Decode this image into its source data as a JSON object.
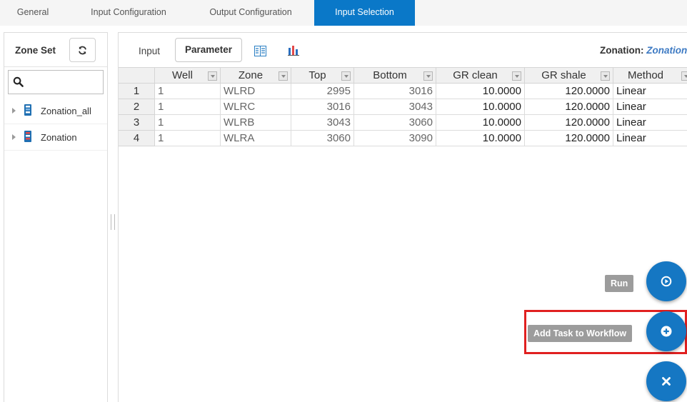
{
  "tabs": [
    {
      "label": "General"
    },
    {
      "label": "Input Configuration"
    },
    {
      "label": "Output Configuration"
    },
    {
      "label": "Input Selection"
    }
  ],
  "active_tab": "Input Selection",
  "left_panel": {
    "title": "Zone Set",
    "search": {
      "value": "",
      "placeholder": ""
    },
    "tree": [
      {
        "label": "Zonation_all"
      },
      {
        "label": "Zonation"
      }
    ]
  },
  "main_panel": {
    "toolbar": {
      "input_label": "Input",
      "parameter_label": "Parameter",
      "icons": [
        "grid-view-icon",
        "bar-chart-icon"
      ]
    },
    "zonation": {
      "label": "Zonation:",
      "value": "Zonation"
    },
    "table": {
      "columns": [
        "Well",
        "Zone",
        "Top",
        "Bottom",
        "GR clean",
        "GR shale",
        "Method"
      ],
      "rows": [
        {
          "num": "1",
          "well": "1",
          "zone": "WLRD",
          "top": "2995",
          "bottom": "3016",
          "gr_clean": "10.0000",
          "gr_shale": "120.0000",
          "method": "Linear"
        },
        {
          "num": "2",
          "well": "1",
          "zone": "WLRC",
          "top": "3016",
          "bottom": "3043",
          "gr_clean": "10.0000",
          "gr_shale": "120.0000",
          "method": "Linear"
        },
        {
          "num": "3",
          "well": "1",
          "zone": "WLRB",
          "top": "3043",
          "bottom": "3060",
          "gr_clean": "10.0000",
          "gr_shale": "120.0000",
          "method": "Linear"
        },
        {
          "num": "4",
          "well": "1",
          "zone": "WLRA",
          "top": "3060",
          "bottom": "3090",
          "gr_clean": "10.0000",
          "gr_shale": "120.0000",
          "method": "Linear"
        }
      ]
    }
  },
  "actions": {
    "run_label": "Run",
    "add_task_label": "Add Task to Workflow"
  },
  "colors": {
    "accent": "#0a78c8",
    "fab": "#1577c3",
    "tooltip_bg": "#9c9c9c",
    "highlight": "#e02020",
    "zonation_value": "#3d7ac3"
  }
}
